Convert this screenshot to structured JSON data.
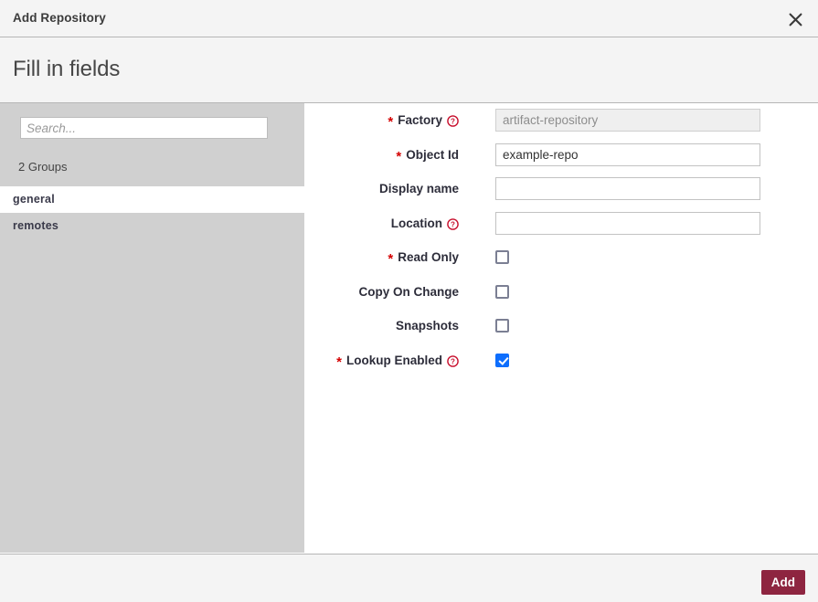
{
  "window": {
    "title": "Add Repository",
    "close_icon": "close-icon"
  },
  "step": {
    "title": "Fill in fields"
  },
  "sidebar": {
    "search": {
      "placeholder": "Search...",
      "value": ""
    },
    "groups_count_label": "2 Groups",
    "items": [
      {
        "label": "general",
        "selected": true
      },
      {
        "label": "remotes",
        "selected": false
      }
    ]
  },
  "form": {
    "fields": [
      {
        "label": "Factory",
        "required": true,
        "help": true,
        "type": "text",
        "value": "artifact-repository",
        "placeholder": "",
        "disabled": true
      },
      {
        "label": "Object Id",
        "required": true,
        "help": false,
        "type": "text",
        "value": "example-repo",
        "placeholder": "",
        "disabled": false
      },
      {
        "label": "Display name",
        "required": false,
        "help": false,
        "type": "text",
        "value": "",
        "placeholder": "",
        "disabled": false
      },
      {
        "label": "Location",
        "required": false,
        "help": true,
        "type": "text",
        "value": "",
        "placeholder": "",
        "disabled": false
      },
      {
        "label": "Read Only",
        "required": true,
        "help": false,
        "type": "checkbox",
        "checked": false
      },
      {
        "label": "Copy On Change",
        "required": false,
        "help": false,
        "type": "checkbox",
        "checked": false
      },
      {
        "label": "Snapshots",
        "required": false,
        "help": false,
        "type": "checkbox",
        "checked": false
      },
      {
        "label": "Lookup Enabled",
        "required": true,
        "help": true,
        "type": "checkbox",
        "checked": true
      }
    ]
  },
  "footer": {
    "add_label": "Add"
  },
  "colors": {
    "accent_button": "#8e2540",
    "required_star": "#d40000",
    "help_icon": "#c8102e",
    "checkbox_checked": "#0d6efd",
    "panel_bg": "#f4f4f4",
    "sidebar_bg": "#d0d0d0"
  }
}
